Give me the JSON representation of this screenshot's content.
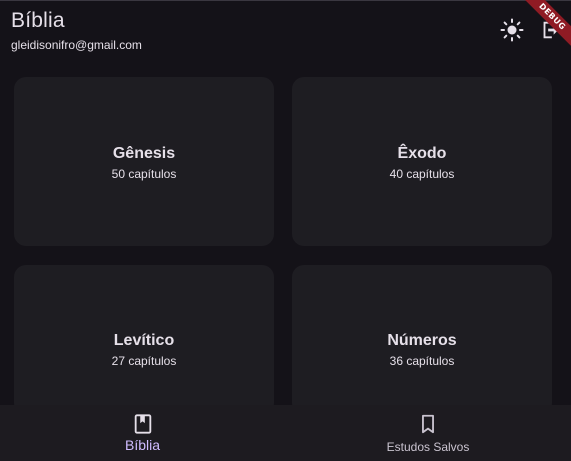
{
  "appbar": {
    "title": "Bíblia",
    "user_email": "gleidisonifro@gmail.com",
    "theme_icon": "sun-icon",
    "logout_icon": "logout-icon"
  },
  "debug_banner": "DEBUG",
  "books": [
    {
      "name": "Gênesis",
      "chapters": "50 capítulos"
    },
    {
      "name": "Êxodo",
      "chapters": "40 capítulos"
    },
    {
      "name": "Levítico",
      "chapters": "27 capítulos"
    },
    {
      "name": "Números",
      "chapters": "36 capítulos"
    }
  ],
  "bottom_nav": {
    "items": [
      {
        "label": "Bíblia",
        "icon": "book-bookmark-icon",
        "selected": true
      },
      {
        "label": "Estudos Salvos",
        "icon": "bookmark-icon",
        "selected": false
      }
    ]
  },
  "colors": {
    "background": "#141218",
    "card": "#1e1d22",
    "nav_background": "#1d1b20",
    "selected": "#d0bcff",
    "debug_ribbon": "#8f1b24"
  }
}
